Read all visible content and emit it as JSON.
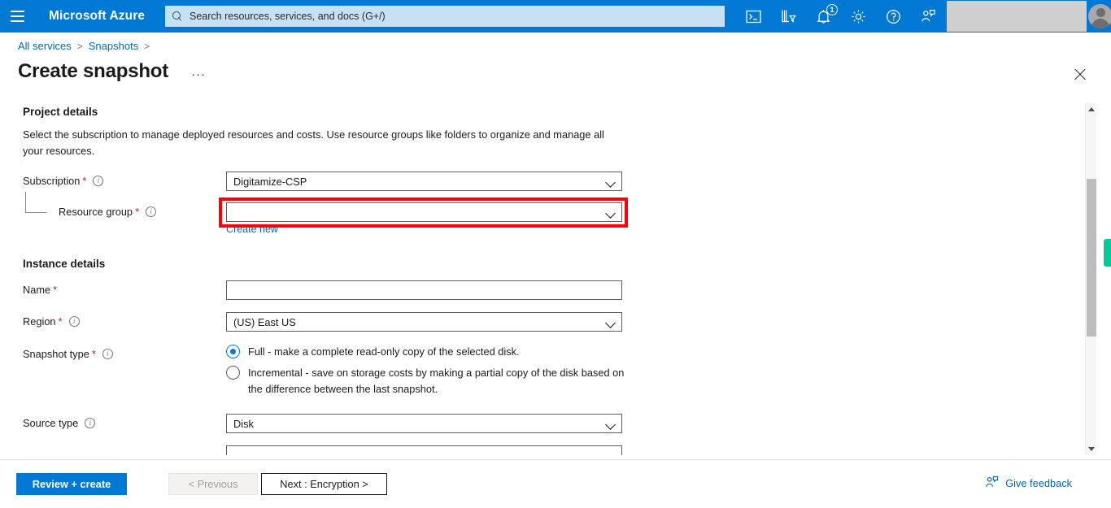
{
  "topnav": {
    "menu_icon": "hamburger-icon",
    "brand": "Microsoft Azure",
    "search_placeholder": "Search resources, services, and docs (G+/)",
    "icons": [
      {
        "name": "cloud-shell-icon",
        "label": "Cloud Shell"
      },
      {
        "name": "directory-filter-icon",
        "label": "Directories + subscriptions"
      },
      {
        "name": "notifications-bell-icon",
        "label": "Notifications",
        "badge": "1"
      },
      {
        "name": "settings-gear-icon",
        "label": "Settings"
      },
      {
        "name": "help-question-icon",
        "label": "Help"
      },
      {
        "name": "feedback-person-icon",
        "label": "Feedback"
      }
    ],
    "account_masked": "",
    "avatar": "user-avatar"
  },
  "breadcrumb": {
    "items": [
      "All services",
      "Snapshots"
    ],
    "separator": ">",
    "trailing_separator": ">"
  },
  "header": {
    "title": "Create snapshot",
    "more_menu": "···",
    "close": "×"
  },
  "form": {
    "project_details": {
      "heading": "Project details",
      "description": "Select the subscription to manage deployed resources and costs. Use resource groups like folders to organize and manage all your resources.",
      "subscription": {
        "label": "Subscription",
        "required": "*",
        "value": "Digitamize-CSP"
      },
      "resource_group": {
        "label": "Resource group",
        "required": "*",
        "value": "",
        "create_new": "Create new",
        "highlighted": true
      }
    },
    "instance_details": {
      "heading": "Instance details",
      "name": {
        "label": "Name",
        "required": "*",
        "value": ""
      },
      "region": {
        "label": "Region",
        "required": "*",
        "value": "(US) East US"
      },
      "snapshot_type": {
        "label": "Snapshot type",
        "required": "*",
        "options": [
          {
            "label": "Full - make a complete read-only copy of the selected disk.",
            "selected": true
          },
          {
            "label": "Incremental - save on storage costs by making a partial copy of the disk based on the difference between the last snapshot.",
            "selected": false
          }
        ]
      },
      "source_type": {
        "label": "Source type",
        "value": "Disk"
      }
    }
  },
  "footer": {
    "review_create": "Review + create",
    "previous": "< Previous",
    "next": "Next : Encryption >",
    "give_feedback": "Give feedback"
  },
  "colors": {
    "azure_blue": "#0078d4",
    "link_blue": "#0067b8",
    "required_red": "#a4262c",
    "highlight_red": "#fb0007",
    "green_marker": "#00cc9b",
    "search_bg": "#c7e0f4"
  }
}
